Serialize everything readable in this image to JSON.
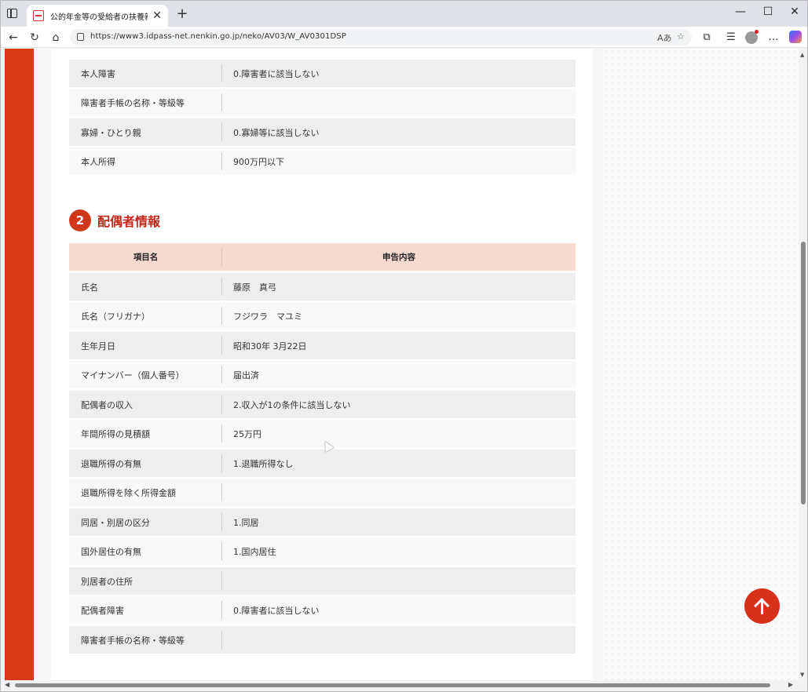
{
  "browser": {
    "tab_title": "公的年金等の受給者の扶養親族等",
    "url": "https://www3.idpass-net.nenkin.go.jp/neko/AV03/W_AV0301DSP",
    "new_tab_label": "+",
    "close_tab_label": "✕",
    "minimize_label": "—",
    "maximize_label": "☐",
    "close_window_label": "✕"
  },
  "previous_section": {
    "rows": [
      {
        "label": "本人障害",
        "value": "0.障害者に該当しない"
      },
      {
        "label": "障害者手帳の名称・等級等",
        "value": ""
      },
      {
        "label": "寡婦・ひとり親",
        "value": "0.寡婦等に該当しない"
      },
      {
        "label": "本人所得",
        "value": "900万円以下"
      }
    ]
  },
  "spouse_section": {
    "number": "2",
    "title": "配偶者情報",
    "header": {
      "item": "項目名",
      "content": "申告内容"
    },
    "rows": [
      {
        "label": "氏名",
        "value": "藤原　真弓"
      },
      {
        "label": "氏名（フリガナ）",
        "value": "フジワラ　マユミ"
      },
      {
        "label": "生年月日",
        "value": "昭和30年 3月22日"
      },
      {
        "label": "マイナンバー（個人番号）",
        "value": "届出済"
      },
      {
        "label": "配偶者の収入",
        "value": "2.収入が1の条件に該当しない"
      },
      {
        "label": "年間所得の見積額",
        "value": "25万円"
      },
      {
        "label": "退職所得の有無",
        "value": "1.退職所得なし"
      },
      {
        "label": "退職所得を除く所得金額",
        "value": ""
      },
      {
        "label": "同居・別居の区分",
        "value": "1.同居"
      },
      {
        "label": "国外居住の有無",
        "value": "1.国内居住"
      },
      {
        "label": "別居者の住所",
        "value": ""
      },
      {
        "label": "配偶者障害",
        "value": "0.障害者に該当しない"
      },
      {
        "label": "障害者手帳の名称・等級等",
        "value": ""
      }
    ]
  },
  "colors": {
    "accent_red": "#d83a17",
    "header_bg": "#f6d9cf",
    "title_red": "#c3261a"
  }
}
